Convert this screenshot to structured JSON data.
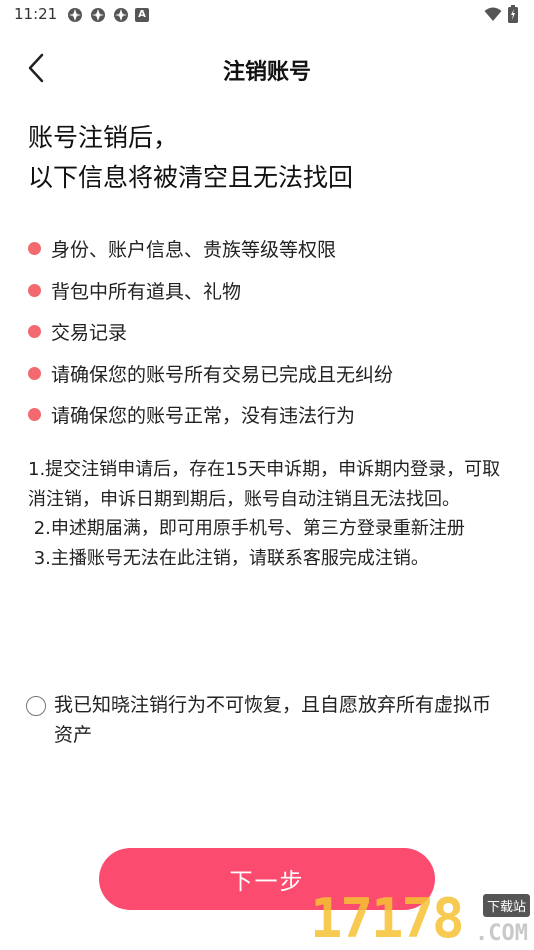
{
  "status_bar": {
    "time": "11:21",
    "icons": [
      "app-notification-icon",
      "app-notification-icon",
      "app-notification-icon",
      "a-badge-icon"
    ],
    "badge_letter": "A",
    "right_icons": [
      "wifi-icon",
      "battery-icon"
    ]
  },
  "nav": {
    "title": "注销账号",
    "back_icon": "chevron-left-icon"
  },
  "headline": {
    "line1": "账号注销后，",
    "line2": "以下信息将被清空且无法找回"
  },
  "bullets": [
    "身份、账户信息、贵族等级等权限",
    "背包中所有道具、礼物",
    "交易记录",
    "请确保您的账号所有交易已完成且无纠纷",
    "请确保您的账号正常，没有违法行为"
  ],
  "colors": {
    "bullet_dot": "#f26a6f",
    "primary_button": "#fb4b6e"
  },
  "notes": [
    "1.提交注销申请后，存在15天申诉期，申诉期内登录，可取消注销，申诉日期到期后，账号自动注销且无法找回。",
    " 2.申述期届满，即可用原手机号、第三方登录重新注册",
    " 3.主播账号无法在此注销，请联系客服完成注销。"
  ],
  "agreement": {
    "checked": false,
    "text": "我已知晓注销行为不可恢复，且自愿放弃所有虚拟币资产"
  },
  "next_button": {
    "label": "下一步"
  },
  "watermark": {
    "digits": "17178",
    "badge": "下载站",
    "suffix": ".COM"
  }
}
